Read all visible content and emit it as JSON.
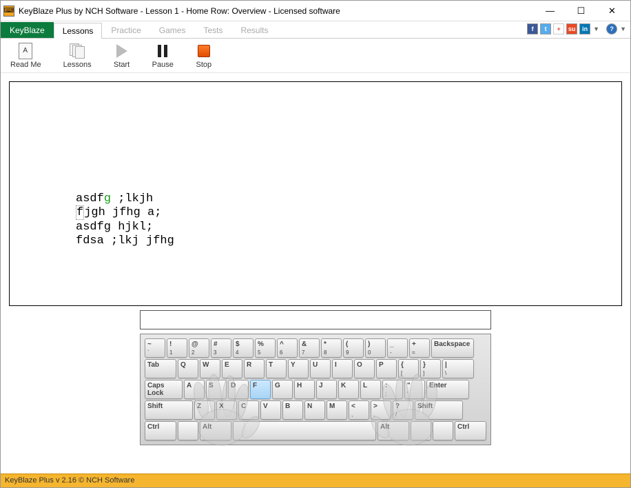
{
  "window": {
    "title": "KeyBlaze Plus by NCH Software - Lesson 1 - Home Row: Overview - Licensed software"
  },
  "tabs": {
    "keyblaze": "KeyBlaze",
    "lessons": "Lessons",
    "practice": "Practice",
    "games": "Games",
    "tests": "Tests",
    "results": "Results"
  },
  "toolbar": {
    "readme": "Read Me",
    "lessons": "Lessons",
    "start": "Start",
    "pause": "Pause",
    "stop": "Stop"
  },
  "lesson": {
    "line1a": "asdf",
    "line1b": "g",
    "line1c": " ;lkjh",
    "line2_cursor": "f",
    "line2_rest": "jgh jfhg a;",
    "line3": "asdfg hjkl;",
    "line4": "fdsa ;lkj jfhg"
  },
  "keyboard_rows": {
    "r1": [
      "~\n`",
      "!\n1",
      "@\n2",
      "#\n3",
      "$\n4",
      "%\n5",
      "^\n6",
      "&\n7",
      "*\n8",
      "(\n9",
      ")\n0",
      "_\n-",
      "+\n=",
      "Backspace"
    ],
    "r2": [
      "Tab",
      "Q",
      "W",
      "E",
      "R",
      "T",
      "Y",
      "U",
      "I",
      "O",
      "P",
      "{\n[",
      "}\n]",
      "|\n\\"
    ],
    "r3": [
      "Caps Lock",
      "A",
      "S",
      "D",
      "F",
      "G",
      "H",
      "J",
      "K",
      "L",
      ":\n;",
      "\"\n'",
      "Enter"
    ],
    "r4": [
      "Shift",
      "Z",
      "X",
      "C",
      "V",
      "B",
      "N",
      "M",
      "<\n,",
      ">\n.",
      "?\n/",
      "Shift"
    ],
    "r5": [
      "Ctrl",
      "",
      "Alt",
      " ",
      "Alt",
      "",
      "",
      "Ctrl"
    ]
  },
  "highlighted_key": "F",
  "status": "KeyBlaze Plus v 2.16 © NCH Software",
  "social_colors": {
    "fb": "#3b5998",
    "tw": "#55acee",
    "gp": "#dd4b39",
    "su": "#eb4924",
    "li": "#0077b5",
    "help": "#2a6fbb"
  }
}
